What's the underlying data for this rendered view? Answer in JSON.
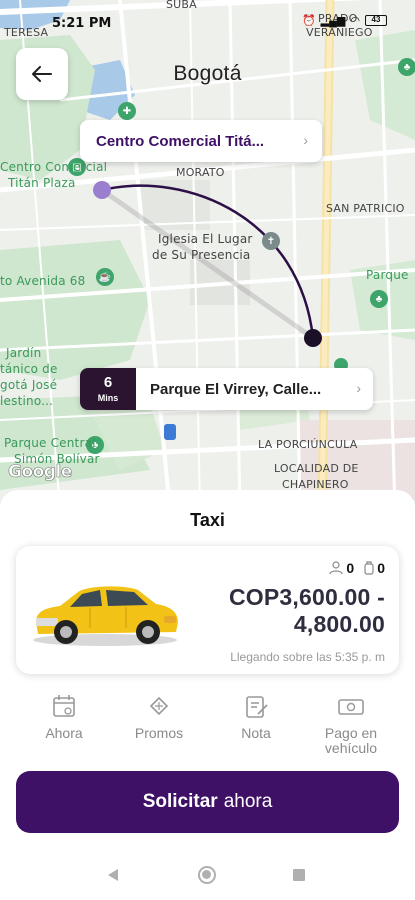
{
  "status_bar": {
    "time": "5:21 PM",
    "battery": "43"
  },
  "header": {
    "city": "Bogotá"
  },
  "map": {
    "labels": {
      "teresa": "TERESA",
      "suba": "SUBA",
      "prado_veraniego_1": "PRADO",
      "prado_veraniego_2": "VERANIEGO",
      "centro_comercial_1": "Centro Comercial",
      "centro_comercial_2": "Titán Plaza",
      "morato": "MORATO",
      "san_patricio": "SAN PATRICIO",
      "iglesia_1": "Iglesia El Lugar",
      "iglesia_2": "de Su Presencia",
      "avenida_68": "to Avenida 68",
      "parque": "Parque",
      "jardin_1": "Jardín",
      "jardin_2": "tánico de",
      "jardin_3": "gotá José",
      "jardin_4": "lestino...",
      "parque_central_1": "Parque Central",
      "parque_central_2": "Simón Bolívar",
      "la_porciuncula": "LA PORCIÚNCULA",
      "localidad_1": "LOCALIDAD DE",
      "localidad_2": "CHAPINERO",
      "google": "Google"
    },
    "origin_label": "Centro Comercial Titá...",
    "destination_label": "Parque El Virrey, Calle...",
    "eta_value": "6",
    "eta_unit": "Mins"
  },
  "colors": {
    "brand": "#3f1166",
    "eta_bg": "#2a1430",
    "origin_dot": "#9b7fcf",
    "dest_dot": "#1c1028",
    "taxi_yellow": "#f2c316"
  },
  "ride": {
    "service_title": "Taxi",
    "passengers": "0",
    "luggage": "0",
    "price_line1": "COP3,600.00 -",
    "price_line2": "4,800.00",
    "arrival": "Llegando sobre las 5:35 p. m"
  },
  "options": [
    {
      "label": "Ahora",
      "icon": "calendar-icon"
    },
    {
      "label": "Promos",
      "icon": "ticket-icon"
    },
    {
      "label": "Nota",
      "icon": "note-icon"
    },
    {
      "label_1": "Pago en",
      "label_2": "vehículo",
      "icon": "cash-icon"
    }
  ],
  "cta": {
    "bold": "Solicitar",
    "regular": "ahora"
  }
}
